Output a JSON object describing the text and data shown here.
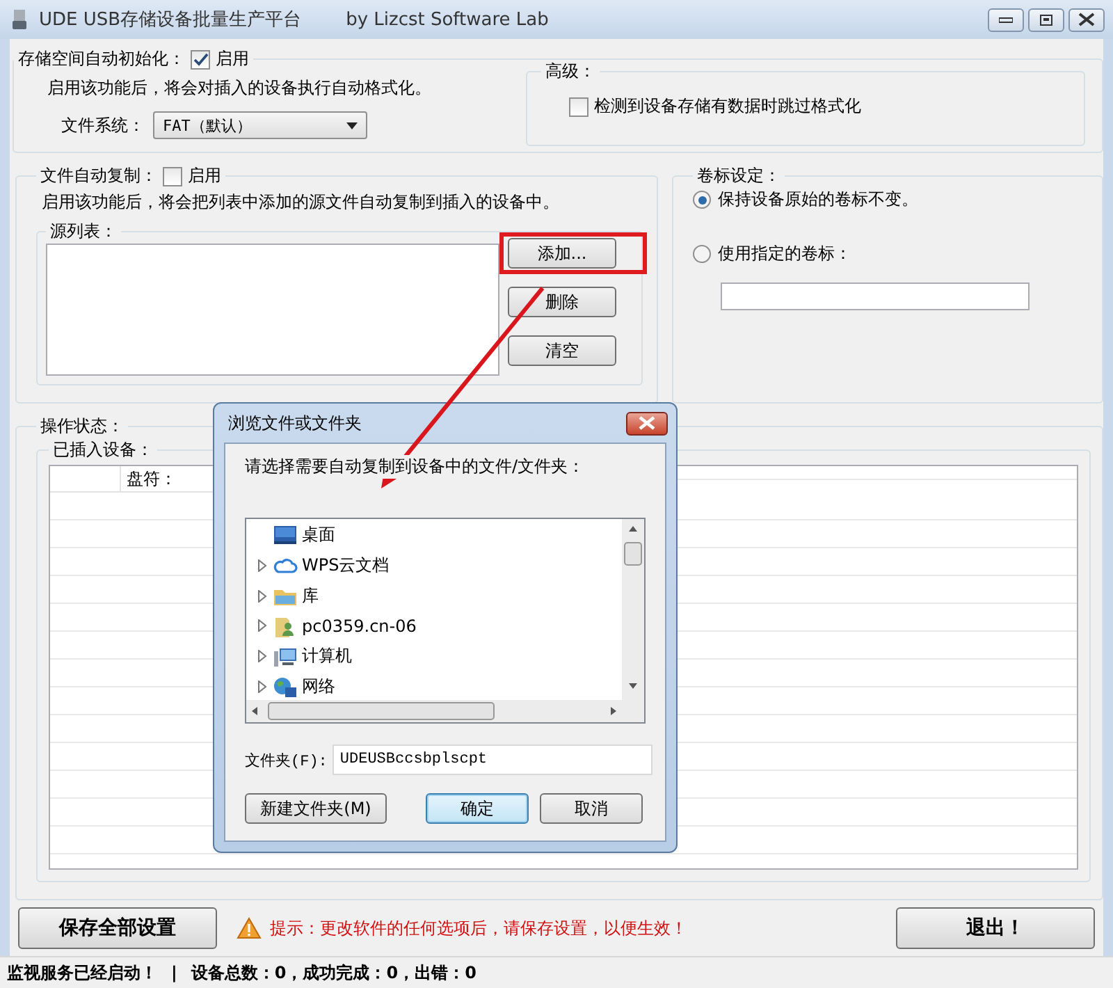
{
  "window": {
    "title": "UDE USB存储设备批量生产平台",
    "subtitle": "by Lizcst Software Lab"
  },
  "auto_format": {
    "title": "存储空间自动初始化：",
    "checkbox": {
      "label": "启用",
      "checked": true
    },
    "description": "启用该功能后，将会对插入的设备执行自动格式化。",
    "file_system": {
      "label": "文件系统：",
      "value": "FAT（默认）"
    }
  },
  "advanced": {
    "title": "高级：",
    "options": [
      {
        "label": "检测到设备存储有数据时跳过格式化",
        "checked": false
      }
    ]
  },
  "auto_copy": {
    "title": "文件自动复制：",
    "checkbox": {
      "label": "启用",
      "checked": false
    },
    "description": "启用该功能后，将会把列表中添加的源文件自动复制到插入的设备中。",
    "source_list": {
      "title": "源列表：",
      "buttons": [
        "添加...",
        "删除",
        "清空"
      ]
    }
  },
  "volume_label": {
    "title": "卷标设定：",
    "options": [
      {
        "label": "保持设备原始的卷标不变。",
        "selected": true
      },
      {
        "label": "使用指定的卷标：",
        "selected": false
      }
    ]
  },
  "status": {
    "title": "操作状态：",
    "devices": {
      "title": "已插入设备：",
      "columns": [
        "盘符："
      ]
    }
  },
  "footer": {
    "save": "保存全部设置",
    "hint": "提示：更改软件的任何选项后，请保存设置，以便生效！",
    "exit": "退出！"
  },
  "status_bar": [
    "监视服务已经启动！",
    "|",
    "设备总数：0，成功完成：0，出错：0"
  ],
  "dialog": {
    "title": "浏览文件或文件夹",
    "prompt": "请选择需要自动复制到设备中的文件/文件夹：",
    "tree": [
      {
        "label": "桌面",
        "kind": "desktop",
        "expandable": false
      },
      {
        "label": "WPS云文档",
        "kind": "cloud",
        "expandable": true
      },
      {
        "label": "库",
        "kind": "library",
        "expandable": true
      },
      {
        "label": "pc0359.cn-06",
        "kind": "user",
        "expandable": true
      },
      {
        "label": "计算机",
        "kind": "computer",
        "expandable": true
      },
      {
        "label": "网络",
        "kind": "network",
        "expandable": true
      }
    ],
    "folder": {
      "label": "文件夹(F):",
      "value": "UDEUSBccsbplscpt"
    },
    "buttons": [
      {
        "label": "新建文件夹(M)",
        "default": false
      },
      {
        "label": "确定",
        "default": true
      },
      {
        "label": "取消",
        "default": false
      }
    ]
  }
}
